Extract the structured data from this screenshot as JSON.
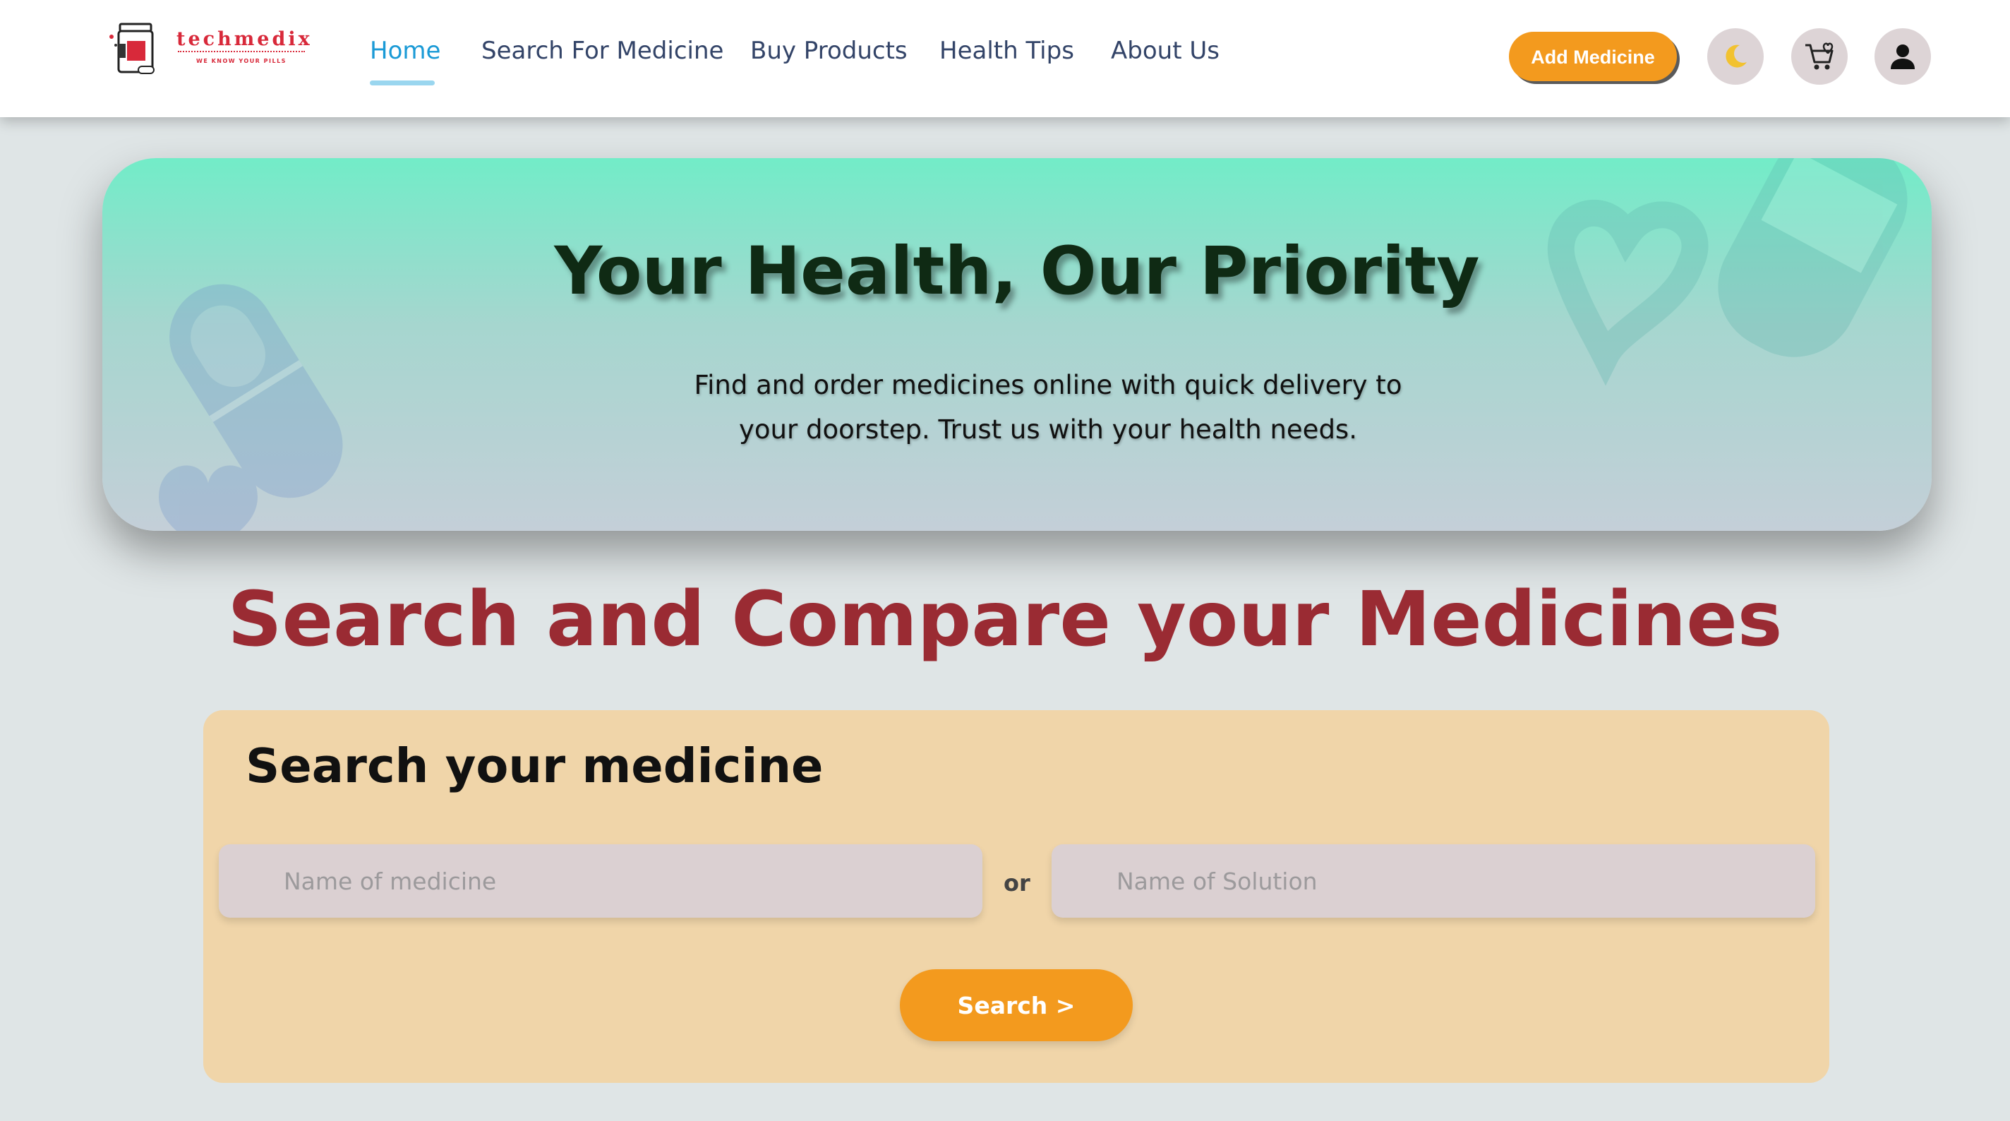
{
  "brand": {
    "name": "techmedix",
    "tagline": "WE KNOW YOUR PILLS",
    "color": "#d8293a"
  },
  "nav": {
    "items": [
      {
        "label": "Home",
        "active": true
      },
      {
        "label": "Search For Medicine",
        "active": false
      },
      {
        "label": "Buy Products",
        "active": false
      },
      {
        "label": "Health Tips",
        "active": false
      },
      {
        "label": "About Us",
        "active": false
      }
    ],
    "active_color": "#1a9ad6",
    "text_color": "#334468"
  },
  "header_actions": {
    "add_medicine_label": "Add Medicine",
    "theme_icon": "moon-icon",
    "cart_icon": "cart-heart-icon",
    "profile_icon": "user-icon",
    "accent": "#f39a1e"
  },
  "hero": {
    "title": "Your Health, Our Priority",
    "subtitle": "Find and order medicines online with quick delivery to your doorstep. Trust us with your health needs.",
    "decorative_icons": [
      "pill-capsule-icon",
      "heart-icon",
      "medicine-bottle-icon"
    ]
  },
  "main": {
    "title": "Search and Compare your Medicines",
    "title_color": "#9a2b33"
  },
  "search_card": {
    "title": "Search your medicine",
    "medicine_placeholder": "Name of medicine",
    "separator": "or",
    "solution_placeholder": "Name of Solution",
    "button_label": "Search >"
  }
}
